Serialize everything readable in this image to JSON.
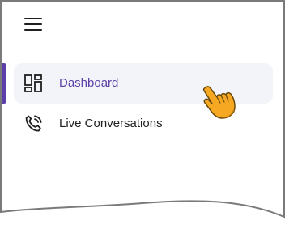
{
  "menu": {
    "icon": "hamburger-menu-icon"
  },
  "nav": {
    "items": [
      {
        "label": "Dashboard",
        "icon": "dashboard-icon",
        "active": true
      },
      {
        "label": "Live Conversations",
        "icon": "phone-call-icon",
        "active": false
      }
    ]
  },
  "cursor": {
    "icon": "hand-pointer-icon"
  },
  "colors": {
    "accent": "#5b3fa8",
    "active_bg": "#f3f4fa",
    "text": "#1f1f1f",
    "cursor_fill": "#f7a823"
  }
}
